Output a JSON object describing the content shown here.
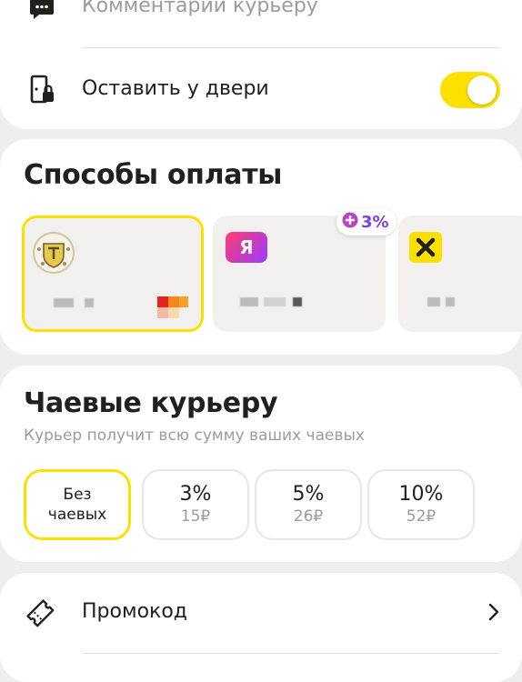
{
  "delivery_options": {
    "courier_comment_label": "Комментарий курьеру",
    "leave_at_door_label": "Оставить у двери",
    "leave_at_door_enabled": true
  },
  "payment": {
    "title": "Способы оплаты",
    "cards": [
      {
        "bank_icon": "tinkoff-logo-icon",
        "selected": true
      },
      {
        "bank_icon": "yandex-logo-icon",
        "logo_text": "Я",
        "selected": false
      },
      {
        "bank_icon": "raiffeisen-logo-icon",
        "selected": false
      }
    ],
    "cashback_badge": "3%"
  },
  "tips": {
    "title": "Чаевые курьеру",
    "subtitle": "Курьер получит всю сумму ваших чаевых",
    "options": [
      {
        "label_line1": "Без",
        "label_line2": "чаевых",
        "selected": true
      },
      {
        "percent": "3%",
        "amount": "15₽",
        "selected": false
      },
      {
        "percent": "5%",
        "amount": "26₽",
        "selected": false
      },
      {
        "percent": "10%",
        "amount": "52₽",
        "selected": false
      }
    ]
  },
  "promo": {
    "label": "Промокод"
  },
  "colors": {
    "accent": "#fce000",
    "background": "#efeeec",
    "card": "#ffffff",
    "plus_purple": "#7b3fe4"
  }
}
